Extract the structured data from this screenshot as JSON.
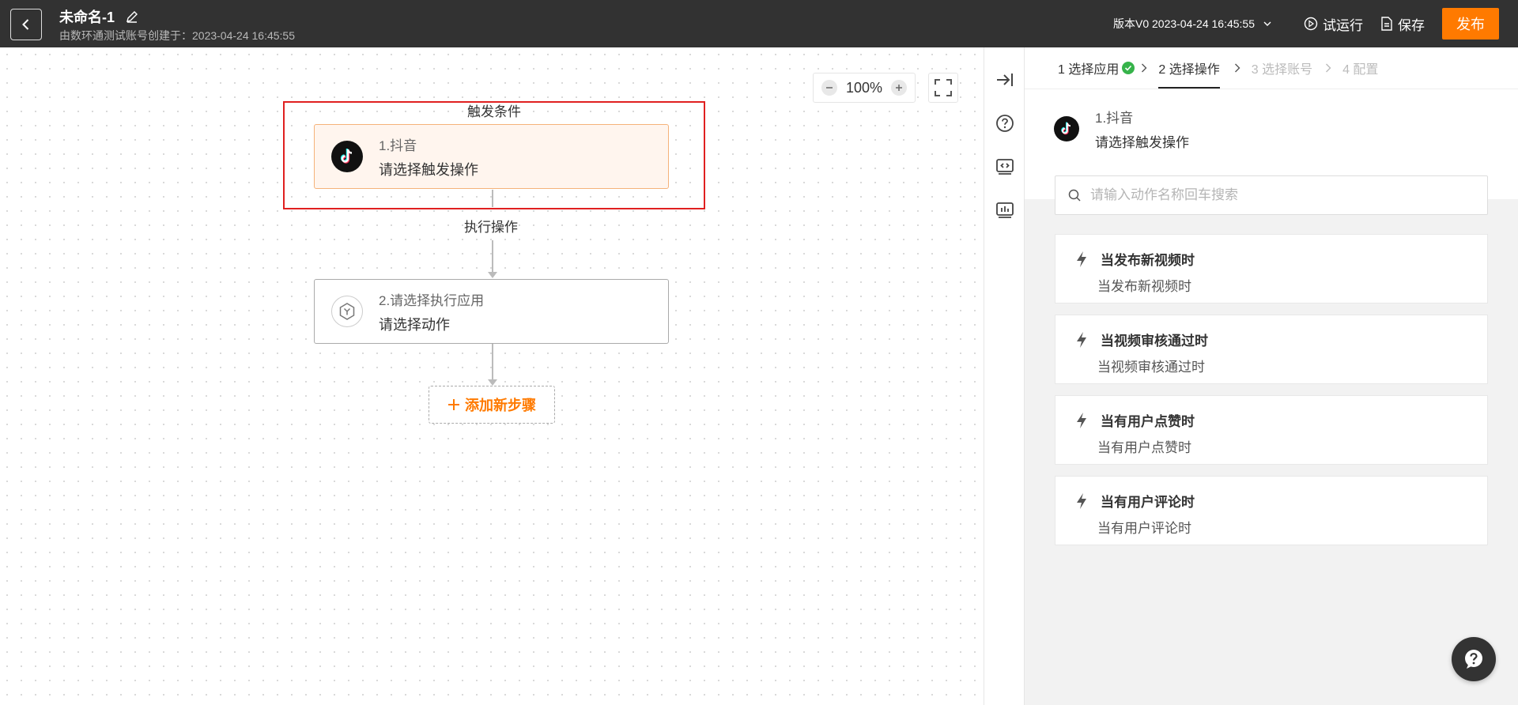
{
  "header": {
    "title": "未命名-1",
    "subtitle": "由数环通测试账号创建于：2023-04-24 16:45:55",
    "version_label": "版本V0 2023-04-24 16:45:55",
    "test_run_label": "试运行",
    "save_label": "保存",
    "publish_label": "发布",
    "icons": [
      "back-arrow-icon",
      "edit-pencil-icon",
      "chevron-down-icon",
      "play-circle-icon",
      "document-icon"
    ]
  },
  "canvas": {
    "zoom_value": "100%",
    "trigger_section_label": "触发条件",
    "action_section_label": "执行操作",
    "nodes": [
      {
        "title": "1.抖音",
        "subtitle": "请选择触发操作",
        "icon": "tiktok-icon"
      },
      {
        "title": "2.请选择执行应用",
        "subtitle": "请选择动作",
        "icon": "app-cube-icon"
      }
    ],
    "add_step_label": "添加新步骤",
    "colors": {
      "accent": "#ff7a00",
      "highlight": "#e02020"
    }
  },
  "panel": {
    "steps": [
      {
        "label": "1 选择应用",
        "state": "done"
      },
      {
        "label": "2 选择操作",
        "state": "active"
      },
      {
        "label": "3 选择账号",
        "state": "disabled"
      },
      {
        "label": "4 配置",
        "state": "disabled"
      }
    ],
    "app_title": "1.抖音",
    "app_subtitle": "请选择触发操作",
    "search_placeholder": "请输入动作名称回车搜索",
    "triggers": [
      {
        "title": "当发布新视频时",
        "desc": "当发布新视频时"
      },
      {
        "title": "当视频审核通过时",
        "desc": "当视频审核通过时"
      },
      {
        "title": "当有用户点赞时",
        "desc": "当有用户点赞时"
      },
      {
        "title": "当有用户评论时",
        "desc": "当有用户评论时"
      }
    ]
  }
}
